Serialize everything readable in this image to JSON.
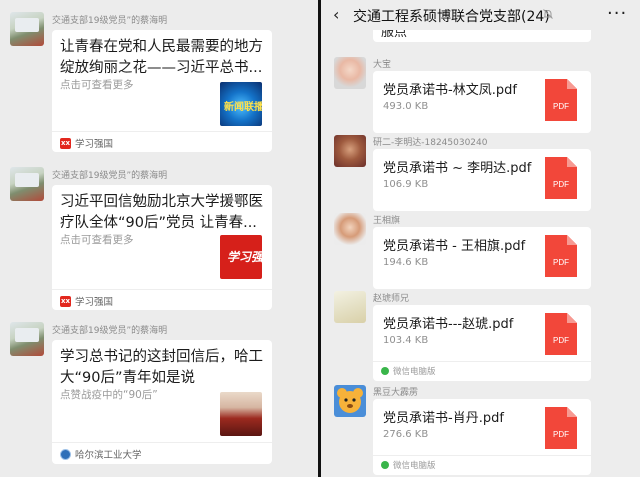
{
  "left_panel": {
    "messages": [
      {
        "sender": "交通支部19级党员”的蔡海明",
        "title": "让青春在党和人民最需要的地方绽放绚丽之花——习近平总书...",
        "desc": "点击可查看更多",
        "thumb_text": "新闻联播",
        "source": "学习强国"
      },
      {
        "sender": "交通支部19级党员”的蔡海明",
        "title": "习近平回信勉励北京大学援鄂医疗队全体“90后”党员 让青春...",
        "desc": "点击可查看更多",
        "thumb_text": "学习强国",
        "source": "学习强国"
      },
      {
        "sender": "交通支部19级党员”的蔡海明",
        "title": "学习总书记的这封回信后，哈工大“90后”青年如是说",
        "desc": "点赞战疫中的“90后”",
        "source": "哈尔滨工业大学"
      }
    ]
  },
  "right_panel": {
    "header": {
      "back": "‹",
      "title": "交通工程系硕博联合党支部(24)",
      "more": "···"
    },
    "prev_fragment": "服点",
    "messages": [
      {
        "sender": "大宝",
        "file": "党员承诺书-林文凤.pdf",
        "size": "493.0 KB",
        "pdf_label": "PDF",
        "source": ""
      },
      {
        "sender": "研二-李明达-18245030240",
        "file": "党员承诺书 ~ 李明达.pdf",
        "size": "106.9 KB",
        "pdf_label": "PDF",
        "source": ""
      },
      {
        "sender": "王相旗",
        "file": "党员承诺书 - 王相旗.pdf",
        "size": "194.6 KB",
        "pdf_label": "PDF",
        "source": ""
      },
      {
        "sender": "赵琥师兄",
        "file": "党员承诺书---赵琥.pdf",
        "size": "103.4 KB",
        "pdf_label": "PDF",
        "source": "微信电脑版"
      },
      {
        "sender": "黑豆大霹雳",
        "file": "党员承诺书-肖丹.pdf",
        "size": "276.6 KB",
        "pdf_label": "PDF",
        "source": "微信电脑版"
      }
    ]
  },
  "icons": {
    "back": "chevron-left-icon",
    "mute": "bell-muted-icon",
    "more": "more-dots-icon",
    "pdf": "pdf-file-icon",
    "xuexi": "xuexi-qiangguo-logo-icon",
    "hit": "hit-university-logo-icon",
    "wechat_pc": "wechat-pc-icon"
  },
  "colors": {
    "pdf_red": "#f2473a",
    "background": "#ececec",
    "card": "#ffffff"
  }
}
